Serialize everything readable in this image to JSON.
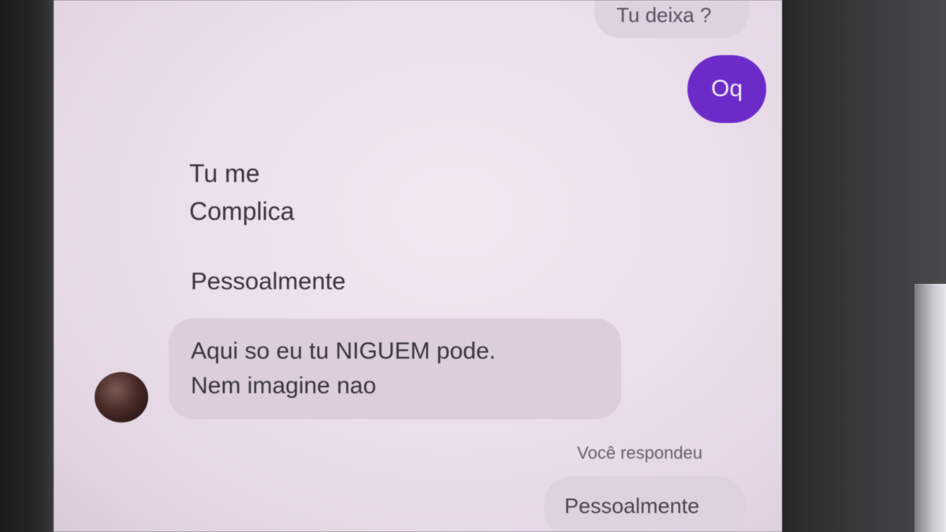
{
  "conversation": {
    "messages": [
      {
        "id": "m1",
        "sender": "me",
        "style": "gray",
        "text": "Tu deixa ?"
      },
      {
        "id": "m2",
        "sender": "me",
        "style": "purple",
        "text": "Oq"
      },
      {
        "id": "m3",
        "sender": "them",
        "style": "plain",
        "text": "Tu me\nComplica"
      },
      {
        "id": "m4",
        "sender": "them",
        "style": "plain",
        "text": "Pessoalmente"
      },
      {
        "id": "m5",
        "sender": "them",
        "style": "bubble",
        "text": "Aqui so eu tu  NIGUEM pode.\nNem imagine nao"
      },
      {
        "id": "m6",
        "sender": "me",
        "style": "gray",
        "text": "Pessoalmente"
      }
    ],
    "reply_label": "Você respondeu"
  },
  "colors": {
    "screen_bg": "#ece0ec",
    "outgoing_accent": "#6c2bc9",
    "incoming_bubble": "#dccedd",
    "text": "#3a3340"
  },
  "icons": {
    "avatar": "contact-avatar"
  }
}
